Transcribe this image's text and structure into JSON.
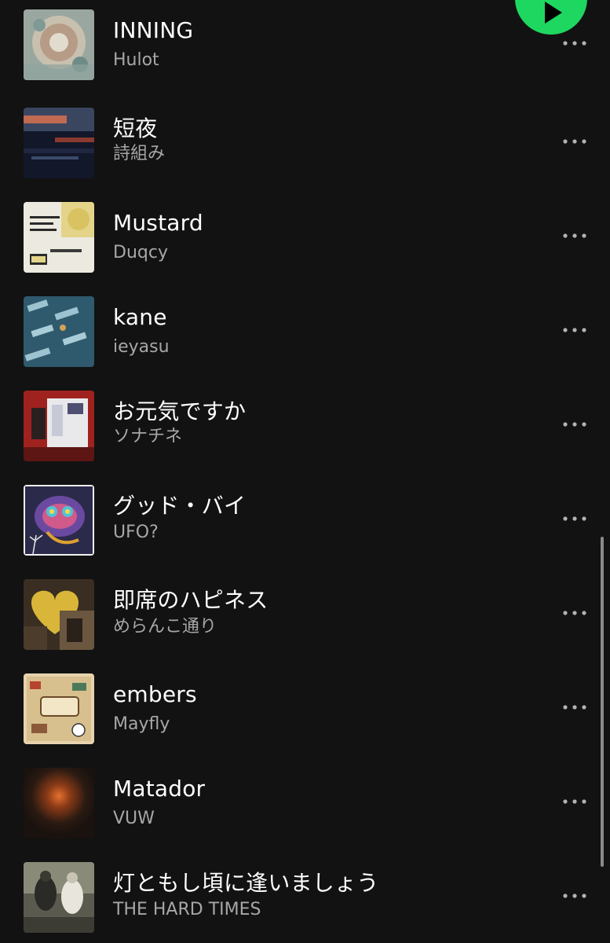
{
  "play_button": {
    "icon": "play-icon",
    "color": "#1ed760"
  },
  "tracks": [
    {
      "title": "INNING",
      "artist": "Hulot"
    },
    {
      "title": "短夜",
      "artist": "詩組み"
    },
    {
      "title": "Mustard",
      "artist": "Duqcy"
    },
    {
      "title": "kane",
      "artist": "ieyasu"
    },
    {
      "title": "お元気ですか",
      "artist": "ソナチネ"
    },
    {
      "title": "グッド・バイ",
      "artist": "UFO?"
    },
    {
      "title": "即席のハピネス",
      "artist": "めらんこ通り"
    },
    {
      "title": "embers",
      "artist": "Mayfly"
    },
    {
      "title": "Matador",
      "artist": "VUW"
    },
    {
      "title": "灯ともし頃に逢いましょう",
      "artist": "THE HARD TIMES"
    }
  ],
  "more_options_icon": "more-horizontal-icon"
}
